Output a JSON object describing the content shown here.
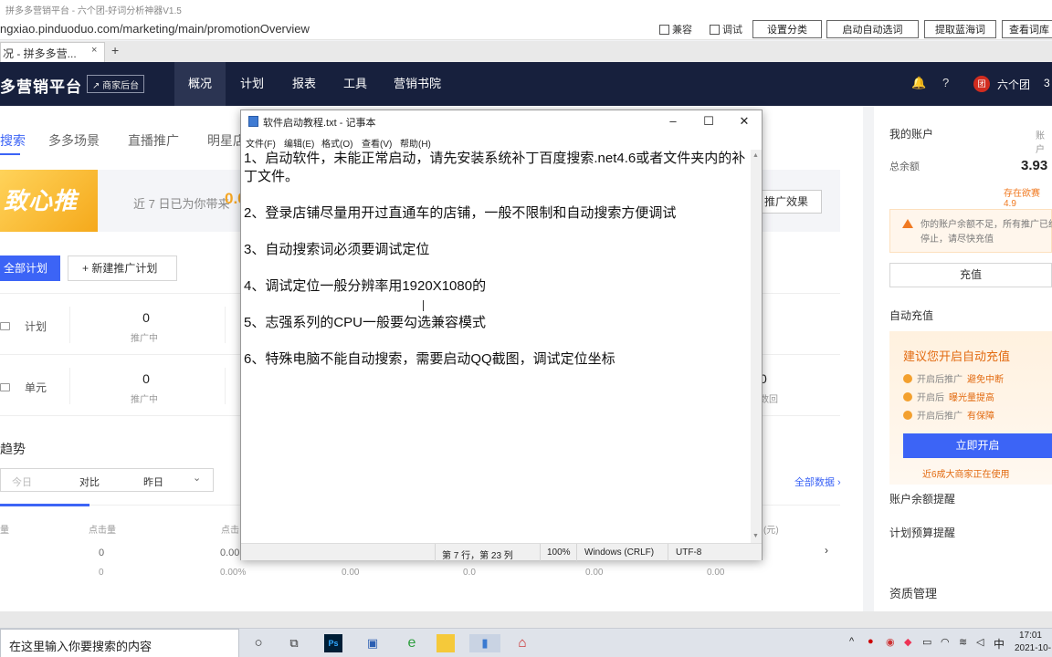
{
  "window": {
    "title": "拼多多营销平台 - 六个团-好词分析神器V1.5",
    "url": "ngxiao.pinduoduo.com/marketing/main/promotionOverview",
    "checkboxes": [
      "兼容",
      "调试"
    ],
    "tool_buttons": [
      "设置分类",
      "启动自动选词",
      "提取蓝海词",
      "查看词库"
    ]
  },
  "browser": {
    "tab_label": "况 - 拼多多营...",
    "tab_close": "×",
    "new_tab": "+"
  },
  "header": {
    "brand": "多营销平台",
    "merchant_btn": "↗ 商家后台",
    "nav": [
      "概况",
      "计划",
      "报表",
      "工具",
      "营销书院"
    ],
    "user": "六个团",
    "user_extra": "3",
    "avatar_text": "团"
  },
  "main": {
    "tabs": [
      "搜索",
      "多多场景",
      "直播推广",
      "明星店"
    ],
    "banner": {
      "logo": "致心推",
      "text": "近 7 日已为你带来",
      "value": "0.0",
      "effect_btn": "推广效果"
    },
    "btn_all": "全部计划",
    "btn_new": "+ 新建推广计划",
    "stats": [
      {
        "label": "计划",
        "value": "0",
        "sub": "推广中",
        "right_value": "",
        "right_sub": ""
      },
      {
        "label": "单元",
        "value": "0",
        "sub": "推广中",
        "right_value": "0",
        "right_sub": "数回"
      }
    ],
    "trend_title": "趋势",
    "filter": {
      "a": "今日",
      "b": "对比",
      "c": "昨日",
      "chev": "⌄"
    },
    "all_data": "全部数据 ›",
    "table": {
      "headers": [
        "量",
        "点击量",
        "点击",
        "(元)"
      ],
      "rows": [
        [
          "0",
          "0.00",
          "",
          "",
          "",
          ""
        ],
        [
          "0",
          "0.00%",
          "0.00",
          "0.0",
          "0.00",
          "0.00"
        ]
      ]
    }
  },
  "right": {
    "account_title": "我的账户",
    "account_link": "账户",
    "balance_label": "总余额",
    "balance": "3.93",
    "stored": "存在欲赛 4.9",
    "warn": "你的账户余额不足，所有推广已经停止，请尽快充值",
    "charge": "充值",
    "auto_title": "自动充值",
    "promo_title": "建议您开启自动充值",
    "promo_items": [
      {
        "pre": "开启后推广",
        "hl": "避免中断"
      },
      {
        "pre": "开启后",
        "hl": "曝光量提高"
      },
      {
        "pre": "开启后推广",
        "hl": "有保障"
      }
    ],
    "promo_btn": "立即开启",
    "promo_note": "近6成大商家正在使用",
    "links": [
      "账户余额提醒",
      "计划预算提醒",
      "资质管理"
    ]
  },
  "notepad": {
    "title": "软件启动教程.txt - 记事本",
    "menus": [
      "文件(F)",
      "编辑(E)",
      "格式(O)",
      "查看(V)",
      "帮助(H)"
    ],
    "lines": [
      "1、启动软件，未能正常启动，请先安装系统补丁百度搜索.net4.6或者文件夹内的补丁文件。",
      "",
      "2、登录店铺尽量用开过直通车的店铺，一般不限制和自动搜索方便调试",
      "",
      "3、自动搜索词必须要调试定位",
      "",
      "4、调试定位一般分辨率用1920X1080的",
      "",
      "5、志强系列的CPU一般要勾选兼容模式",
      "",
      "6、特殊电脑不能自动搜索，需要启动QQ截图，调试定位坐标"
    ],
    "status": {
      "pos": "第 7 行，第 23 列",
      "zoom": "100%",
      "eol": "Windows (CRLF)",
      "enc": "UTF-8"
    }
  },
  "taskbar": {
    "search_placeholder": "在这里输入你要搜索的内容",
    "time": "17:01",
    "date": "2021-10-"
  }
}
